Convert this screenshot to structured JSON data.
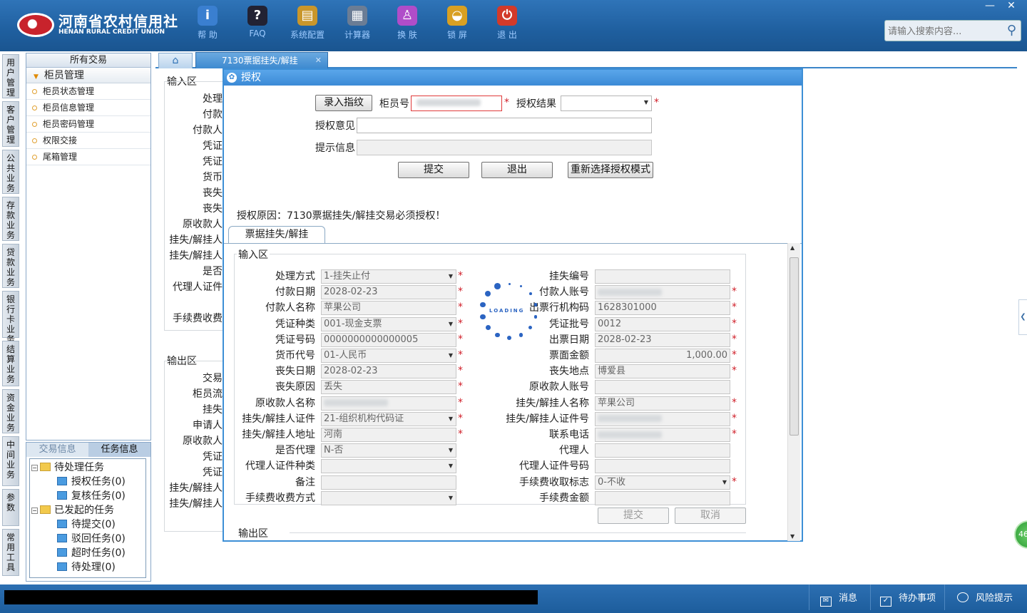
{
  "app": {
    "logo_cn": "河南省农村信用社",
    "logo_en": "HENAN RURAL CREDIT UNION",
    "toolbar": [
      {
        "label": "帮 助",
        "icon": "info-icon",
        "glyph": "i",
        "color": "#3a7fd0"
      },
      {
        "label": "FAQ",
        "icon": "question-icon",
        "glyph": "?",
        "color": "#223"
      },
      {
        "label": "系统配置",
        "icon": "toolbox-icon",
        "glyph": "▤",
        "color": "#c9962b"
      },
      {
        "label": "计算器",
        "icon": "calculator-icon",
        "glyph": "▦",
        "color": "#6b7d95"
      },
      {
        "label": "换 肤",
        "icon": "shirt-icon",
        "glyph": "♙",
        "color": "#b04dc9"
      },
      {
        "label": "锁 屏",
        "icon": "lock-icon",
        "glyph": "◒",
        "color": "#d9a022"
      },
      {
        "label": "退 出",
        "icon": "power-icon",
        "glyph": "⏻",
        "color": "#d23a2a"
      }
    ],
    "window_controls": {
      "minimize": "—",
      "close": "✕"
    },
    "search_placeholder": "请输入搜索内容..."
  },
  "vnav": [
    "用户管理",
    "客户管理",
    "公共业务",
    "存款业务",
    "贷款业务",
    "银行卡业务",
    "结算业务",
    "资金业务",
    "中间业务",
    "参数",
    "常用工具"
  ],
  "menu": {
    "header": "所有交易",
    "group": "柜员管理",
    "items": [
      "柜员状态管理",
      "柜员信息管理",
      "柜员密码管理",
      "权限交接",
      "尾箱管理"
    ]
  },
  "tasks": {
    "tabs": [
      "交易信息",
      "任务信息"
    ],
    "tree": [
      {
        "label": "待处理任务",
        "level": 0,
        "type": "folder"
      },
      {
        "label": "授权任务(0)",
        "level": 1,
        "type": "leaf"
      },
      {
        "label": "复核任务(0)",
        "level": 1,
        "type": "leaf"
      },
      {
        "label": "已发起的任务",
        "level": 0,
        "type": "folder"
      },
      {
        "label": "待提交(0)",
        "level": 1,
        "type": "leaf"
      },
      {
        "label": "驳回任务(0)",
        "level": 1,
        "type": "leaf"
      },
      {
        "label": "超时任务(0)",
        "level": 1,
        "type": "leaf"
      },
      {
        "label": "待处理(0)",
        "level": 1,
        "type": "leaf"
      }
    ]
  },
  "tabs": {
    "home_icon": "home-icon",
    "main": "7130票据挂失/解挂",
    "close": "✕"
  },
  "background_form": {
    "input_area": "输入区",
    "input_labels": [
      "处理",
      "付款",
      "付款人",
      "凭证",
      "凭证",
      "货币",
      "丧失",
      "丧失",
      "原收款人",
      "挂失/解挂人",
      "挂失/解挂人",
      "是否",
      "代理人证件",
      "",
      "手续费收费"
    ],
    "output_area": "输出区",
    "output_labels": [
      "交易",
      "柜员流",
      "挂失",
      "申请人",
      "原收款人",
      "凭证",
      "凭证",
      "挂失/解挂人",
      "挂失/解挂人"
    ]
  },
  "dialog": {
    "title": "授权",
    "fingerprint_button": "录入指纹",
    "teller_label": "柜员号",
    "result_label": "授权结果",
    "opinion_label": "授权意见",
    "hint_label": "提示信息",
    "submit": "提交",
    "exit": "退出",
    "reselect": "重新选择授权模式",
    "reason": "授权原因：7130票据挂失/解挂交易必须授权！",
    "subtab": "票据挂失/解挂",
    "input_area": "输入区",
    "output_area": "输出区",
    "loading_text": "LOADING",
    "left_fields": [
      {
        "label": "处理方式",
        "value": "1-挂失止付",
        "select": true,
        "required": true
      },
      {
        "label": "付款日期",
        "value": "2028-02-23",
        "select": false,
        "required": true
      },
      {
        "label": "付款人名称",
        "value": "苹果公司",
        "select": false,
        "required": true
      },
      {
        "label": "凭证种类",
        "value": "001-现金支票",
        "select": true,
        "required": true
      },
      {
        "label": "凭证号码",
        "value": "0000000000000005",
        "select": false,
        "required": true
      },
      {
        "label": "货币代号",
        "value": "01-人民币",
        "select": true,
        "required": true
      },
      {
        "label": "丧失日期",
        "value": "2028-02-23",
        "select": false,
        "required": true
      },
      {
        "label": "丧失原因",
        "value": "丢失",
        "select": false,
        "required": true
      },
      {
        "label": "原收款人名称",
        "value": "",
        "select": false,
        "required": true,
        "blurred": true
      },
      {
        "label": "挂失/解挂人证件",
        "value": "21-组织机构代码证",
        "select": true,
        "required": true
      },
      {
        "label": "挂失/解挂人地址",
        "value": "河南",
        "select": false,
        "required": true
      },
      {
        "label": "是否代理",
        "value": "N-否",
        "select": true,
        "required": false
      },
      {
        "label": "代理人证件种类",
        "value": "",
        "select": true,
        "required": false
      },
      {
        "label": "备注",
        "value": "",
        "select": false,
        "required": false
      },
      {
        "label": "手续费收费方式",
        "value": "",
        "select": true,
        "required": false
      }
    ],
    "right_fields": [
      {
        "label": "挂失编号",
        "value": "",
        "select": false,
        "required": false
      },
      {
        "label": "付款人账号",
        "value": "",
        "select": false,
        "required": true,
        "blurred": true
      },
      {
        "label": "出票行机构码",
        "value": "1628301000",
        "select": false,
        "required": true
      },
      {
        "label": "凭证批号",
        "value": "0012",
        "select": false,
        "required": true
      },
      {
        "label": "出票日期",
        "value": "2028-02-23",
        "select": false,
        "required": true
      },
      {
        "label": "票面金额",
        "value": "1,000.00",
        "select": false,
        "required": true,
        "align": "right"
      },
      {
        "label": "丧失地点",
        "value": "博爱县",
        "select": false,
        "required": true
      },
      {
        "label": "原收款人账号",
        "value": "",
        "select": false,
        "required": false
      },
      {
        "label": "挂失/解挂人名称",
        "value": "苹果公司",
        "select": false,
        "required": true
      },
      {
        "label": "挂失/解挂人证件号",
        "value": "",
        "select": false,
        "required": true,
        "blurred": true
      },
      {
        "label": "联系电话",
        "value": "",
        "select": false,
        "required": true,
        "blurred": true
      },
      {
        "label": "代理人",
        "value": "",
        "select": false,
        "required": false
      },
      {
        "label": "代理人证件号码",
        "value": "",
        "select": false,
        "required": false
      },
      {
        "label": "手续费收取标志",
        "value": "0-不收",
        "select": true,
        "required": true
      },
      {
        "label": "手续费金额",
        "value": "",
        "select": false,
        "required": false
      }
    ],
    "inner_submit": "提交",
    "inner_cancel": "取消"
  },
  "statusbar": {
    "messages": "消息",
    "todo": "待办事项",
    "risk": "风险提示"
  },
  "floating_badge": "46",
  "colors": {
    "accent": "#3b8ad6",
    "required": "#d0202a",
    "topbar": "#2f74b8"
  }
}
